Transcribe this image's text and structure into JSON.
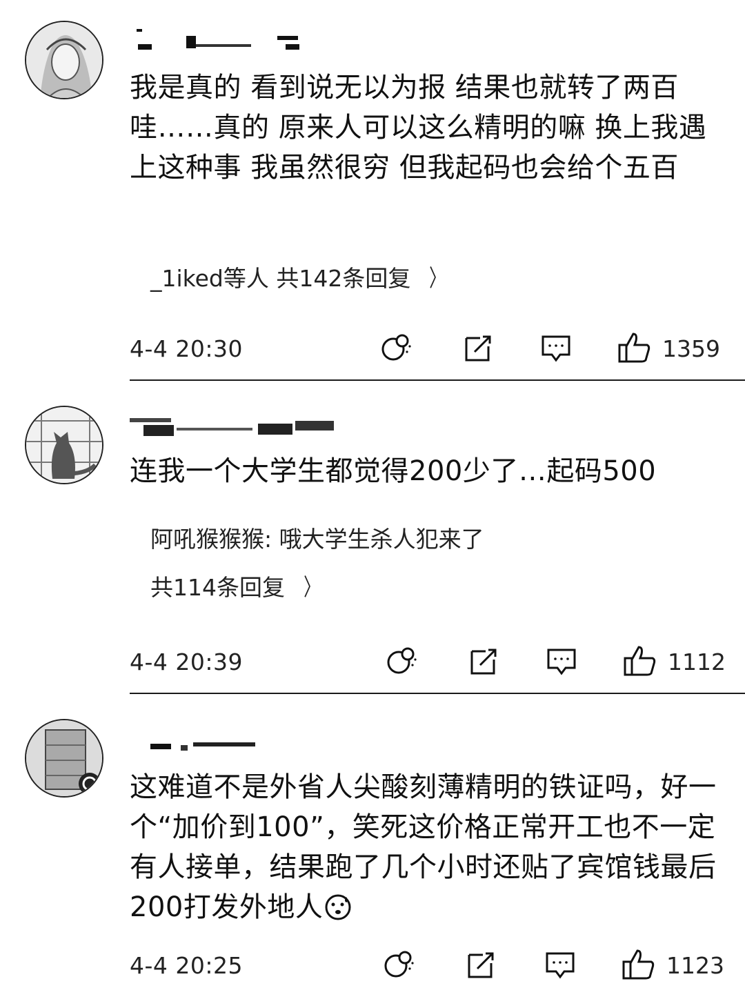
{
  "comments": [
    {
      "text": "我是真的 看到说无以为报 结果也就转了两百 哇……真的 原来人可以这么精明的嘛 换上我遇上这种事 我虽然很穷 但我起码也会给个五百",
      "reply_summary": "_1iked等人  共142条回复",
      "time": "4-4 20:30",
      "likes": "1359"
    },
    {
      "text": "连我一个大学生都觉得200少了…起码500",
      "reply_preview_name": "阿吼猴猴猴: ",
      "reply_preview_text": "哦大学生杀人犯来了",
      "reply_summary": "共114条回复",
      "time": "4-4 20:39",
      "likes": "1112"
    },
    {
      "text": "这难道不是外省人尖酸刻薄精明的铁证吗，好一个“加价到100”，笑死这价格正常开工也不一定有人接单，结果跑了几个小时还贴了宾馆钱最后200打发外地人",
      "emoji": "sweat-face-icon",
      "time": "4-4 20:25",
      "likes": "1123"
    }
  ],
  "icons": [
    "dislike-bubble-icon",
    "share-icon",
    "reply-icon",
    "thumbs-up-icon",
    "chevron-right-icon"
  ],
  "colors": {
    "text": "#111111",
    "divider": "#1a1a1a",
    "background": "#ffffff"
  }
}
